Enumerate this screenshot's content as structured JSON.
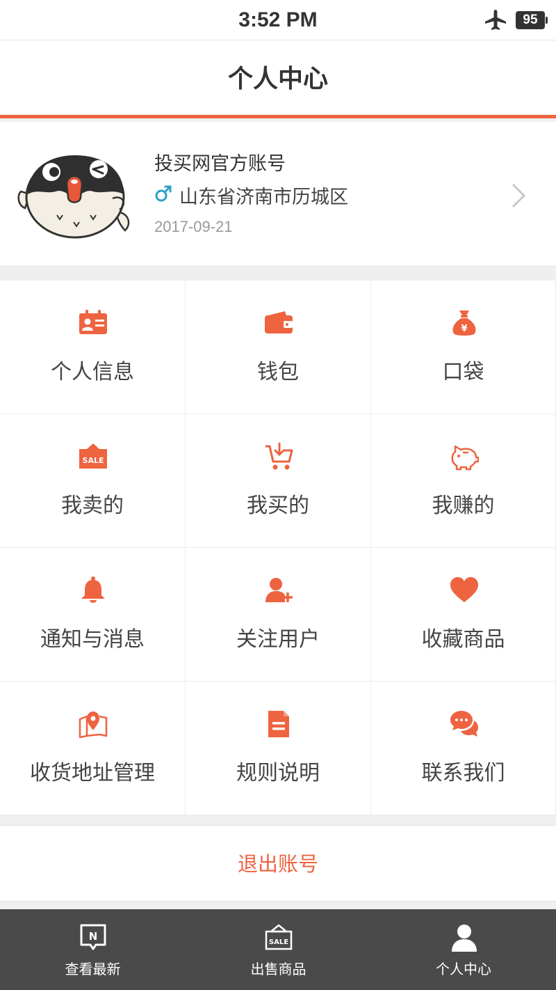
{
  "status_bar": {
    "time": "3:52 PM",
    "battery": "95"
  },
  "header": {
    "title": "个人中心"
  },
  "profile": {
    "name": "投买网官方账号",
    "gender_symbol": "♂",
    "location": "山东省济南市历城区",
    "date": "2017-09-21"
  },
  "menu": [
    {
      "label": "个人信息",
      "icon": "id-card-icon"
    },
    {
      "label": "钱包",
      "icon": "wallet-icon"
    },
    {
      "label": "口袋",
      "icon": "money-bag-icon"
    },
    {
      "label": "我卖的",
      "icon": "sale-tag-icon"
    },
    {
      "label": "我买的",
      "icon": "shopping-cart-icon"
    },
    {
      "label": "我赚的",
      "icon": "piggy-bank-icon"
    },
    {
      "label": "通知与消息",
      "icon": "bell-icon"
    },
    {
      "label": "关注用户",
      "icon": "add-user-icon"
    },
    {
      "label": "收藏商品",
      "icon": "heart-icon"
    },
    {
      "label": "收货地址管理",
      "icon": "map-pin-icon"
    },
    {
      "label": "规则说明",
      "icon": "document-icon"
    },
    {
      "label": "联系我们",
      "icon": "chat-bubbles-icon"
    }
  ],
  "logout": {
    "label": "退出账号"
  },
  "tabbar": [
    {
      "label": "查看最新",
      "icon": "new-badge-icon",
      "active": false
    },
    {
      "label": "出售商品",
      "icon": "sale-shop-icon",
      "active": false
    },
    {
      "label": "个人中心",
      "icon": "user-icon",
      "active": true
    }
  ],
  "colors": {
    "accent": "#ee6340",
    "tabbar_bg": "#4a4a4a",
    "gender_male": "#2aa2c8"
  }
}
